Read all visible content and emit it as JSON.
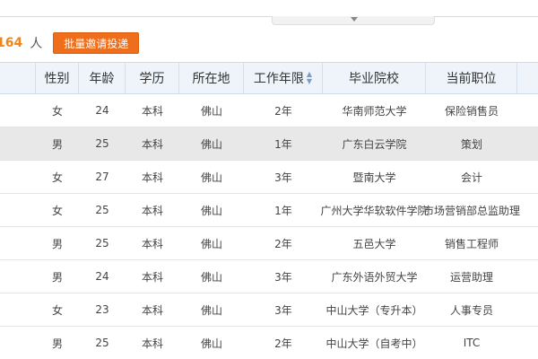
{
  "result": {
    "count": "164",
    "unit": "人",
    "invite_button": "批量邀请投递"
  },
  "columns": {
    "gender": "性别",
    "age": "年龄",
    "education": "学历",
    "location": "所在地",
    "work_years": "工作年限",
    "school": "毕业院校",
    "position": "当前职位"
  },
  "sort_icon": "sort-arrows-icon",
  "rows": [
    {
      "lead": "",
      "lead_link": false,
      "gender": "女",
      "age": "24",
      "education": "本科",
      "location": "佛山",
      "work_years": "2年",
      "school": "华南师范大学",
      "position": "保险销售员",
      "trail": ""
    },
    {
      "lead": "",
      "lead_link": false,
      "gender": "男",
      "age": "25",
      "education": "本科",
      "location": "佛山",
      "work_years": "1年",
      "school": "广东白云学院",
      "position": "策划",
      "trail": ""
    },
    {
      "lead": "",
      "lead_link": false,
      "gender": "女",
      "age": "27",
      "education": "本科",
      "location": "佛山",
      "work_years": "3年",
      "school": "暨南大学",
      "position": "会计",
      "trail": ""
    },
    {
      "lead": "",
      "lead_link": false,
      "gender": "女",
      "age": "25",
      "education": "本科",
      "location": "佛山",
      "work_years": "1年",
      "school": "广州大学华软软件学院",
      "position": "市场营销部总监助理",
      "trail": ""
    },
    {
      "lead": "",
      "lead_link": false,
      "gender": "男",
      "age": "25",
      "education": "本科",
      "location": "佛山",
      "work_years": "2年",
      "school": "五邑大学",
      "position": "销售工程师",
      "trail": ""
    },
    {
      "lead": "",
      "lead_link": true,
      "gender": "男",
      "age": "24",
      "education": "本科",
      "location": "佛山",
      "work_years": "3年",
      "school": "广东外语外贸大学",
      "position": "运营助理",
      "trail": ""
    },
    {
      "lead": "",
      "lead_link": false,
      "gender": "女",
      "age": "23",
      "education": "本科",
      "location": "佛山",
      "work_years": "3年",
      "school": "中山大学（专升本）",
      "position": "人事专员",
      "trail": ""
    },
    {
      "lead": "",
      "lead_link": false,
      "gender": "男",
      "age": "25",
      "education": "本科",
      "location": "佛山",
      "work_years": "2年",
      "school": "中山大学（自考中）",
      "position": "ITC",
      "trail": ""
    }
  ]
}
